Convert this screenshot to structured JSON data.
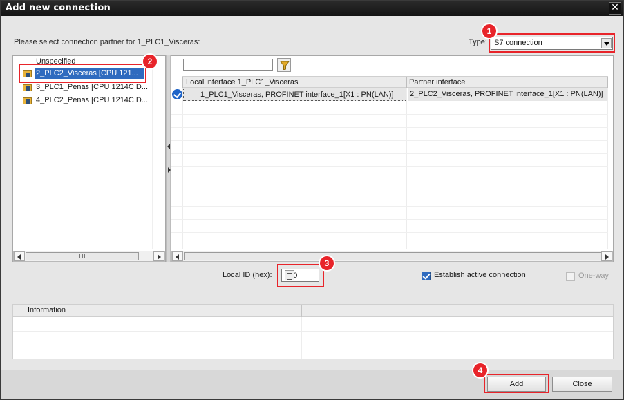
{
  "window": {
    "title": "Add new connection",
    "close_glyph": "✕"
  },
  "prompt": "Please select connection partner for 1_PLC1_Visceras:",
  "type_field": {
    "label": "Type:",
    "value": "S7 connection"
  },
  "partner_tree": [
    {
      "label": "Unspecified",
      "icon": "none",
      "selected": false
    },
    {
      "label": "2_PLC2_Visceras [CPU 121...",
      "icon": "plc-folder-icon",
      "selected": true
    },
    {
      "label": "3_PLC1_Penas [CPU 1214C D...",
      "icon": "plc-folder-icon",
      "selected": false
    },
    {
      "label": "4_PLC2_Penas [CPU 1214C D...",
      "icon": "plc-folder-icon",
      "selected": false
    }
  ],
  "interfaces_grid": {
    "filter_value": "",
    "columns": [
      "Local interface 1_PLC1_Visceras",
      "Partner interface"
    ],
    "rows": [
      {
        "checked": true,
        "local": "1_PLC1_Visceras, PROFINET interface_1[X1 : PN(LAN)]",
        "partner": "2_PLC2_Visceras, PROFINET interface_1[X1 : PN(LAN)]"
      }
    ]
  },
  "local_id": {
    "label": "Local ID (hex):",
    "value": "100"
  },
  "options": {
    "establish_active": {
      "label": "Establish active connection",
      "checked": true
    },
    "one_way": {
      "label": "One-way",
      "checked": false,
      "enabled": false
    }
  },
  "info_panel": {
    "header": "Information"
  },
  "buttons": {
    "add": "Add",
    "close": "Close"
  },
  "callouts": [
    "1",
    "2",
    "3",
    "4"
  ],
  "colors": {
    "accent_red": "#e8242a",
    "selection_blue": "#2f6bbf",
    "titlebar": "#1a1a1a"
  }
}
